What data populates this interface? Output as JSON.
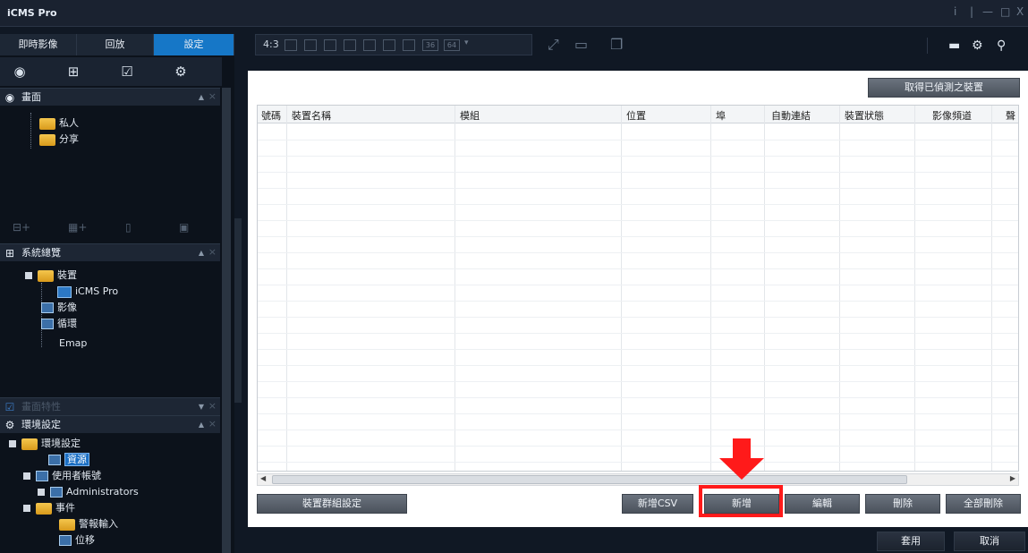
{
  "window": {
    "title": "iCMS Pro",
    "controls": [
      "i",
      "|",
      "—",
      "□",
      "X"
    ]
  },
  "main_tabs": [
    {
      "label": "即時影像"
    },
    {
      "label": "回放"
    },
    {
      "label": "設定"
    }
  ],
  "sections": {
    "screen": {
      "title": "畫面"
    },
    "overview": {
      "title": "系統總覽"
    },
    "props": {
      "title": "畫面特性"
    },
    "env": {
      "title": "環境設定"
    }
  },
  "screen_tree": {
    "private": "私人",
    "share": "分享"
  },
  "overview_tree": {
    "device": "裝置",
    "icms": "iCMS Pro",
    "video": "影像",
    "loop": "循環",
    "emap": "Emap"
  },
  "env_tree": {
    "root": "環境設定",
    "resource": "資源",
    "user_account": "使用者帳號",
    "admins": "Administrators",
    "event": "事件",
    "alarm_input": "警報輸入",
    "motion": "位移"
  },
  "toolbar": {
    "ratio": "4:3",
    "layout36": "36",
    "layout64": "64"
  },
  "detect_button": "取得已偵測之裝置",
  "table": {
    "columns": [
      "號碼",
      "裝置名稱",
      "模組",
      "位置",
      "埠",
      "自動連結",
      "裝置狀態",
      "影像頻道",
      "聲"
    ]
  },
  "buttons": {
    "group_settings": "裝置群組設定",
    "add_csv": "新增CSV",
    "add": "新增",
    "edit": "編輯",
    "delete": "刪除",
    "delete_all": "全部刪除",
    "apply": "套用",
    "cancel": "取消"
  },
  "colors": {
    "accent": "#1677c7",
    "highlight": "#ff1a1a"
  }
}
